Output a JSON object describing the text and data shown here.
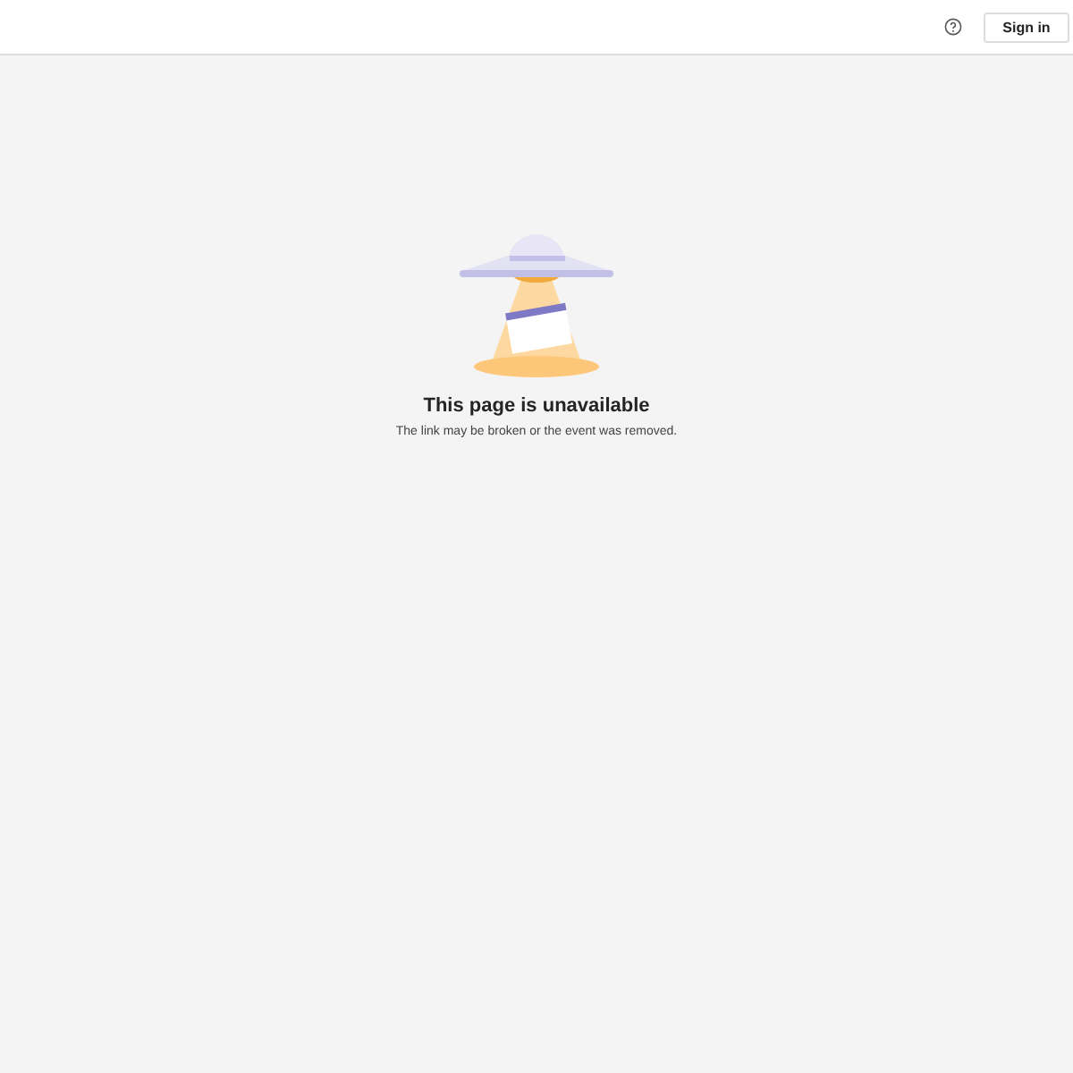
{
  "header": {
    "sign_in_label": "Sign in"
  },
  "message": {
    "title": "This page is unavailable",
    "subtitle": "The link may be broken or the event was removed."
  }
}
